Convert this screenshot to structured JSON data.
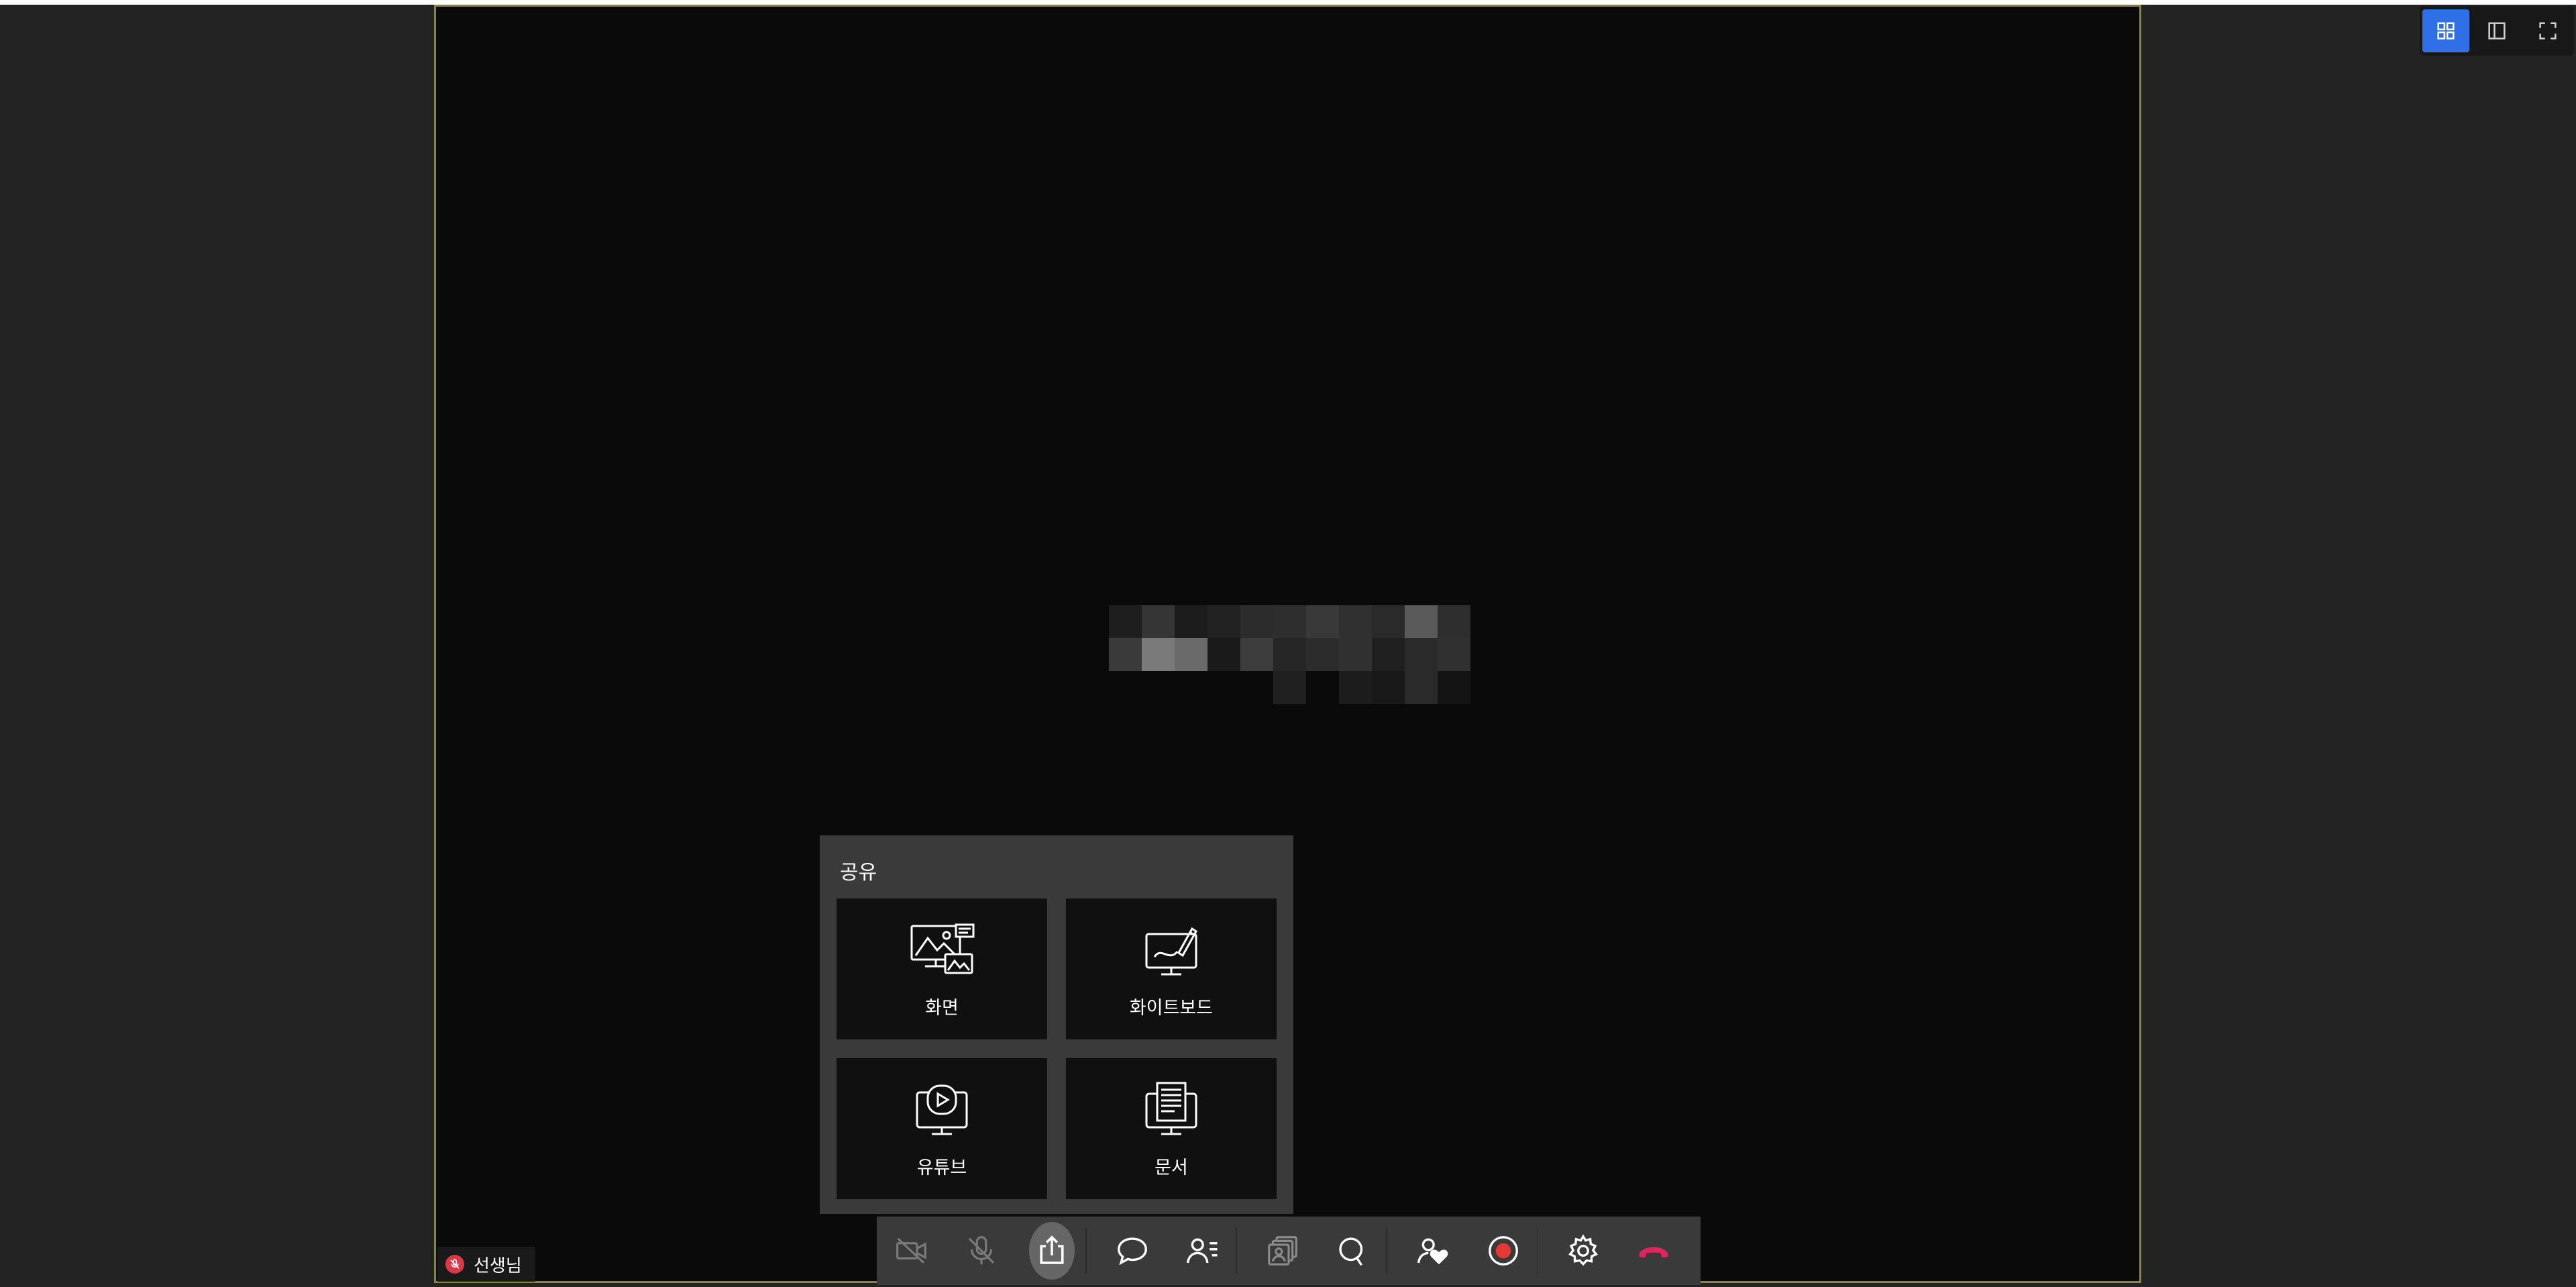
{
  "share": {
    "title": "공유",
    "items": [
      {
        "label": "화면",
        "icon": "screen-share-icon"
      },
      {
        "label": "화이트보드",
        "icon": "whiteboard-icon"
      },
      {
        "label": "유튜브",
        "icon": "youtube-icon"
      },
      {
        "label": "문서",
        "icon": "document-icon"
      }
    ]
  },
  "toolbar": {
    "buttons": [
      "camera-off-icon",
      "mic-off-icon",
      "share-icon",
      "chat-icon",
      "participants-icon",
      "gallery-icon",
      "search-icon",
      "hand-heart-icon",
      "record-icon",
      "settings-icon",
      "hangup-icon"
    ]
  },
  "participant": {
    "name": "선생님"
  },
  "view_controls": [
    "grid-view-icon",
    "sidebar-view-icon",
    "fullscreen-icon"
  ],
  "colors": {
    "accent": "#2f6fe8",
    "hangup": "#e0245e",
    "record": "#e53935",
    "stage_border": "#8c8630",
    "panel": "#3a3a3a"
  }
}
